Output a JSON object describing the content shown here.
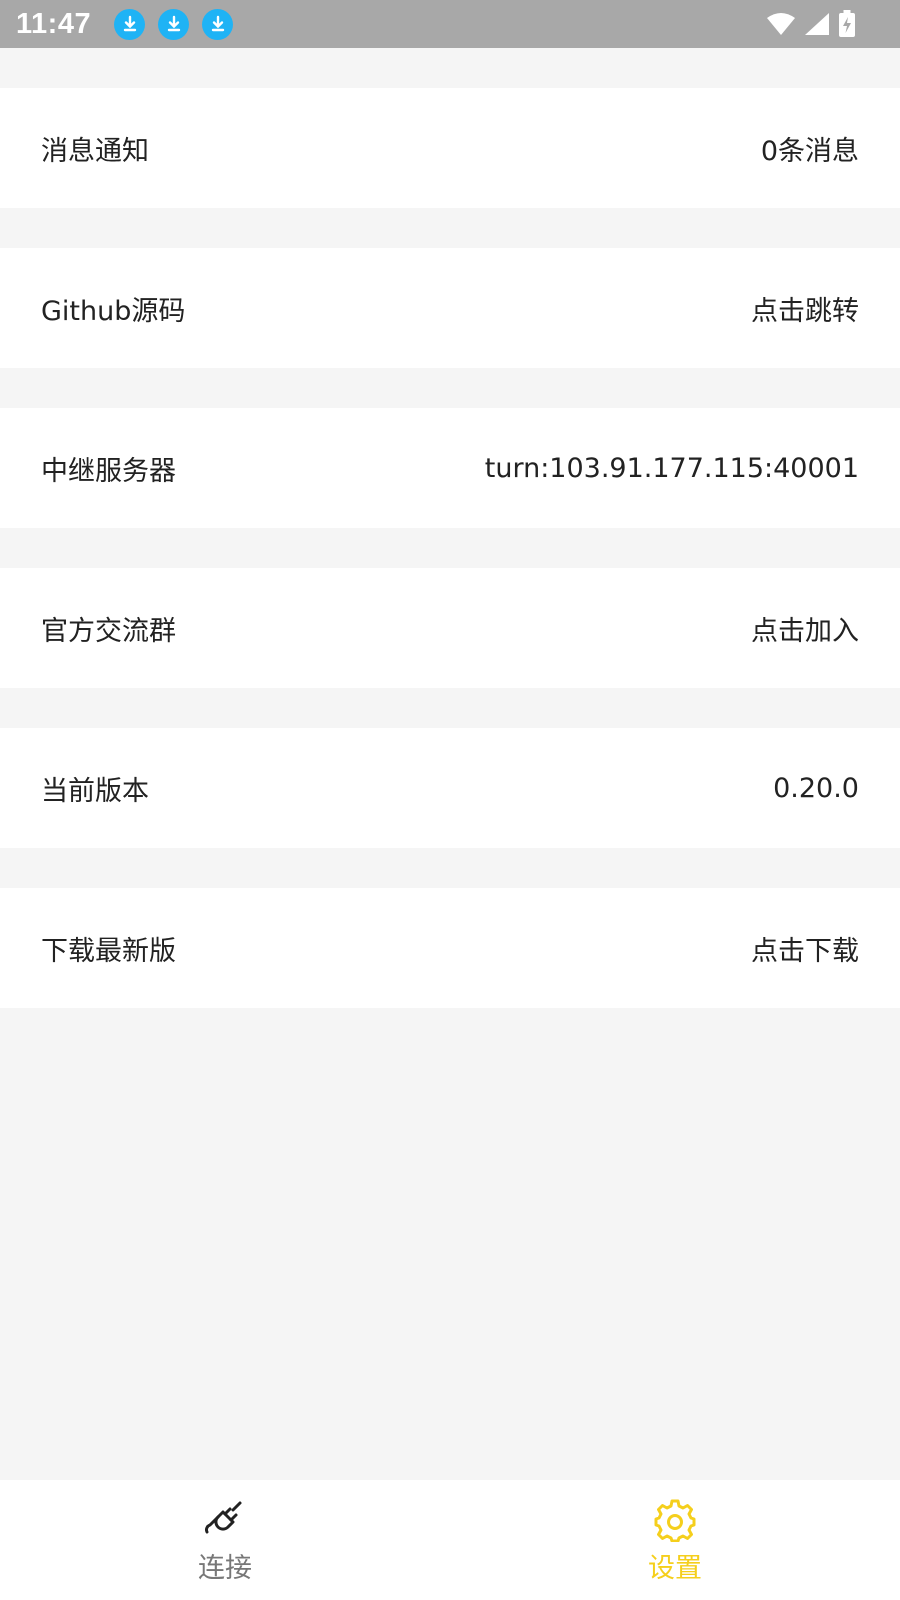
{
  "status_bar": {
    "time": "11:47",
    "notification_icons": [
      "download-icon",
      "download-icon",
      "download-icon"
    ],
    "right_icons": [
      "wifi-icon",
      "signal-icon",
      "battery-charging-icon"
    ]
  },
  "settings": {
    "items": [
      {
        "label": "消息通知",
        "value": "0条消息"
      },
      {
        "label": "Github源码",
        "value": "点击跳转"
      },
      {
        "label": "中继服务器",
        "value": "turn:103.91.177.115:40001"
      },
      {
        "label": "官方交流群",
        "value": "点击加入"
      },
      {
        "label": "当前版本",
        "value": "0.20.0"
      },
      {
        "label": "下载最新版",
        "value": "点击下载"
      }
    ]
  },
  "bottom_nav": {
    "tabs": [
      {
        "label": "连接",
        "icon": "plug-icon",
        "active": false
      },
      {
        "label": "设置",
        "icon": "gear-icon",
        "active": true
      }
    ],
    "active_color": "#f5cf1c",
    "inactive_color": "#777777"
  }
}
